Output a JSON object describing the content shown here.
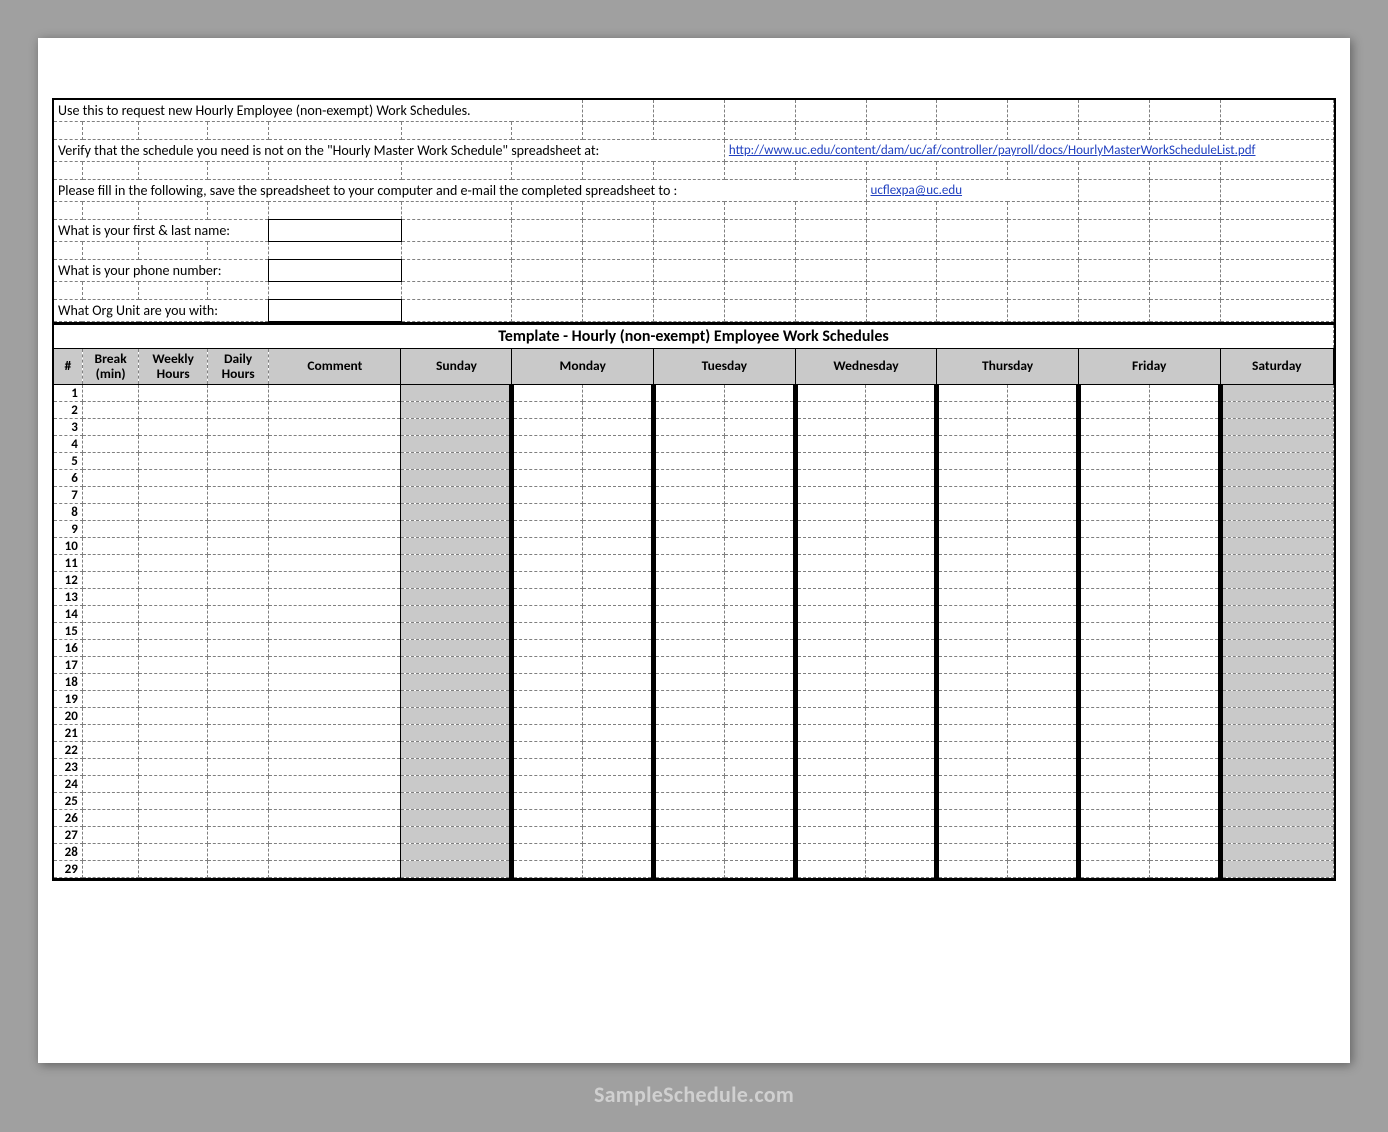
{
  "watermark": "SampleSchedule.com",
  "info": {
    "line1": "Use this to request new Hourly Employee (non-exempt) Work Schedules.",
    "line2": "Verify that the schedule you need is not on the \"Hourly Master Work Schedule\" spreadsheet at:",
    "link1": "http://www.uc.edu/content/dam/uc/af/controller/payroll/docs/HourlyMasterWorkScheduleList.pdf",
    "line3": "Please fill in the following, save the spreadsheet to your computer and e-mail the completed spreadsheet to :",
    "email": "ucflexpa@uc.edu",
    "q1": "What is your first & last name:",
    "q2": "What is your phone number:",
    "q3": "What Org Unit are you with:"
  },
  "template_title": "Template - Hourly (non-exempt) Employee Work Schedules",
  "headers": {
    "num": "#",
    "break": "Break (min)",
    "weekly": "Weekly Hours",
    "daily": "Daily Hours",
    "comment": "Comment",
    "sunday": "Sunday",
    "monday": "Monday",
    "tuesday": "Tuesday",
    "wednesday": "Wednesday",
    "thursday": "Thursday",
    "friday": "Friday",
    "saturday": "Saturday"
  },
  "row_count": 29
}
